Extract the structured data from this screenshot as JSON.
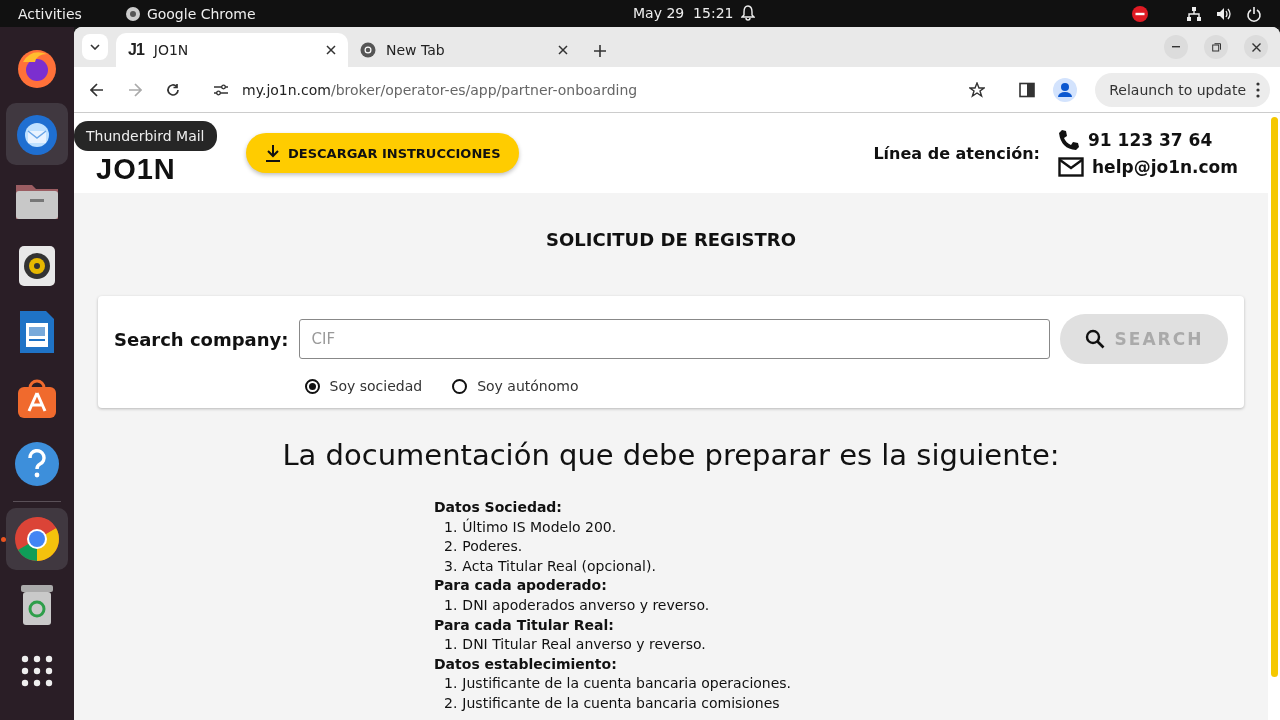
{
  "top_bar": {
    "activities": "Activities",
    "app": "Google Chrome",
    "date": "May 29",
    "time": "15:21"
  },
  "dock": {
    "items": [
      {
        "kind": "firefox",
        "hovered": false,
        "running": false
      },
      {
        "kind": "mail",
        "hovered": true,
        "running": false
      },
      {
        "kind": "files",
        "hovered": false,
        "running": false
      },
      {
        "kind": "music",
        "hovered": false,
        "running": false
      },
      {
        "kind": "writer",
        "hovered": false,
        "running": false
      },
      {
        "kind": "store",
        "hovered": false,
        "running": false
      },
      {
        "kind": "help",
        "hovered": false,
        "running": false
      },
      {
        "kind": "chrome",
        "hovered": false,
        "running": true
      },
      {
        "kind": "trash",
        "hovered": false,
        "running": false
      },
      {
        "kind": "apps",
        "hovered": false,
        "running": false
      }
    ],
    "tooltip": "Thunderbird Mail"
  },
  "tabs": [
    {
      "kind": "jo1n",
      "favicon_text": "J1",
      "title": "JO1N",
      "selected": true
    },
    {
      "kind": "chrome",
      "title": "New Tab",
      "selected": false
    }
  ],
  "address_bar": {
    "domain": "my.jo1n.com",
    "path": "/broker/operator-es/app/partner-onboarding"
  },
  "relaunch_button": "Relaunch to update",
  "header": {
    "logo": "JO1N",
    "download_button": "DESCARGAR INSTRUCCIONES",
    "support_label": "Línea de atención:",
    "phone": "91 123 37 64",
    "email": "help@jo1n.com"
  },
  "title": "SOLICITUD DE REGISTRO",
  "search": {
    "label": "Search company:",
    "placeholder": "CIF",
    "button": "SEARCH",
    "disabled": true,
    "radios": [
      {
        "label": "Soy sociedad",
        "selected": true
      },
      {
        "label": "Soy autónomo",
        "selected": false
      }
    ]
  },
  "documentation": {
    "heading": "La documentación que debe preparar es la siguiente:",
    "sections": [
      {
        "heading": "Datos Sociedad:",
        "items": [
          {
            "number": "1.",
            "text": "Último IS Modelo 200."
          },
          {
            "number": "2.",
            "text": "Poderes."
          },
          {
            "number": "3.",
            "text": "Acta Titular Real (opcional)."
          }
        ]
      },
      {
        "heading": "Para cada apoderado:",
        "items": [
          {
            "number": "1.",
            "text": "DNI apoderados anverso y reverso."
          }
        ]
      },
      {
        "heading": "Para cada Titular Real:",
        "items": [
          {
            "number": "1.",
            "text": "DNI Titular Real anverso y reverso."
          }
        ]
      },
      {
        "heading": "Datos establecimiento:",
        "items": [
          {
            "number": "1.",
            "text": "Justificante de la cuenta bancaria operaciones."
          },
          {
            "number": "2.",
            "text": "Justificante de la cuenta bancaria comisiones"
          }
        ]
      }
    ]
  }
}
